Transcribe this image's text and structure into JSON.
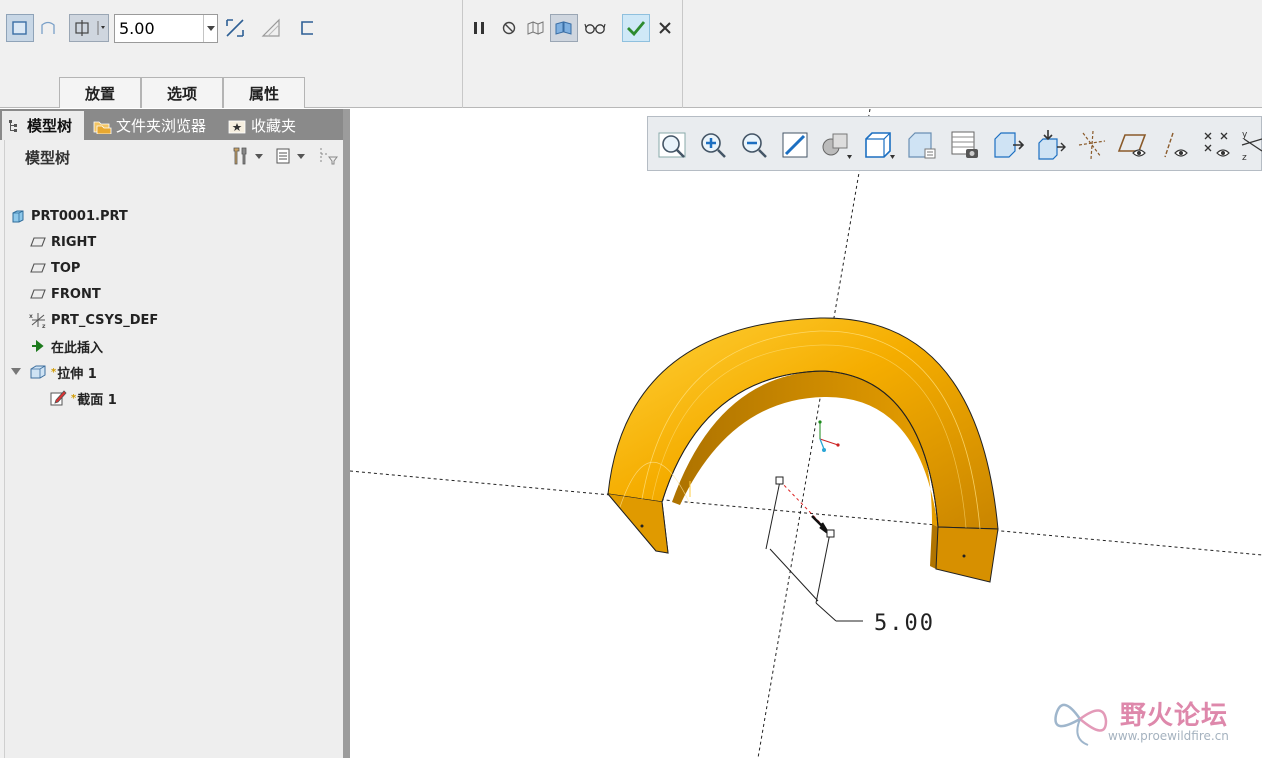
{
  "dashboard": {
    "depth_value": "5.00",
    "tabs": [
      {
        "label": "放置"
      },
      {
        "label": "选项"
      },
      {
        "label": "属性"
      }
    ],
    "icons": {
      "solid": "extrude-solid-icon",
      "surface": "extrude-surface-icon",
      "depth_option": "depth-blind-icon",
      "flip": "flip-direction-icon",
      "remove": "remove-material-icon",
      "thicken": "thicken-sketch-icon",
      "pause": "pause-icon",
      "no_preview": "no-preview-icon",
      "preview_geom": "geometry-preview-icon",
      "preview_feature": "feature-preview-icon",
      "verify": "verify-preview-icon",
      "ok": "ok-checkmark-icon",
      "cancel": "cancel-x-icon"
    }
  },
  "panel": {
    "tabs": [
      {
        "label": "模型树"
      },
      {
        "label": "文件夹浏览器"
      },
      {
        "label": "收藏夹"
      }
    ],
    "tree_title": "模型树",
    "tree": [
      {
        "label": "PRT0001.PRT"
      },
      {
        "label": "RIGHT"
      },
      {
        "label": "TOP"
      },
      {
        "label": "FRONT"
      },
      {
        "label": "PRT_CSYS_DEF"
      },
      {
        "label": "在此插入"
      },
      {
        "label": "拉伸 1",
        "marker": "*"
      },
      {
        "label": "截面 1",
        "marker": "*"
      }
    ]
  },
  "view_toolbar": {
    "icons": [
      "refit-icon",
      "zoom-in-icon",
      "zoom-out-icon",
      "repaint-icon",
      "display-style-icon",
      "saved-orientation-icon",
      "named-views-icon",
      "layers-icon",
      "section-view-icon",
      "spin-center-icon",
      "datum-axes-icon",
      "datum-planes-icon",
      "datum-axis-display-icon",
      "datum-points-icon",
      "csys-display-icon"
    ]
  },
  "graphics": {
    "dimension_text": "5.00",
    "part_color": "#f2a500",
    "watermark": {
      "title": "野火论坛",
      "url": "www.proewildfire.cn"
    }
  }
}
